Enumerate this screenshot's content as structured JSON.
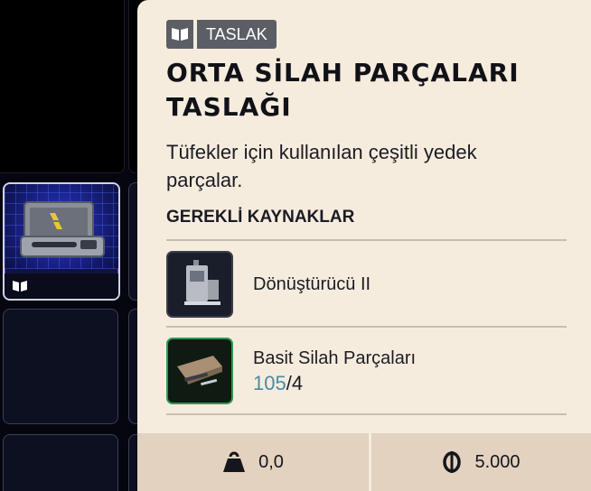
{
  "tag": {
    "icon": "book-icon",
    "label": "TASLAK"
  },
  "title": "ORTA SİLAH PARÇALARI TASLAĞI",
  "description": "Tüfekler için kullanılan çeşitli yedek parçalar.",
  "requirements": {
    "heading": "GEREKLİ KAYNAKLAR",
    "items": [
      {
        "name": "Dönüştürücü II",
        "icon": "converter-machine-icon"
      },
      {
        "name": "Basit Silah Parçaları",
        "have": "105",
        "separator": "/",
        "need": "4",
        "icon": "weapon-parts-icon"
      }
    ]
  },
  "footer": {
    "weight": {
      "icon": "weight-icon",
      "value": "0,0"
    },
    "value": {
      "icon": "coin-icon",
      "value": "5.000"
    }
  },
  "colors": {
    "panel": "#f6ecde",
    "tag": "#5c5e66",
    "have": "#4a8aa6",
    "footer": "#e2d2bf",
    "rare_border": "#2f9a4f"
  }
}
